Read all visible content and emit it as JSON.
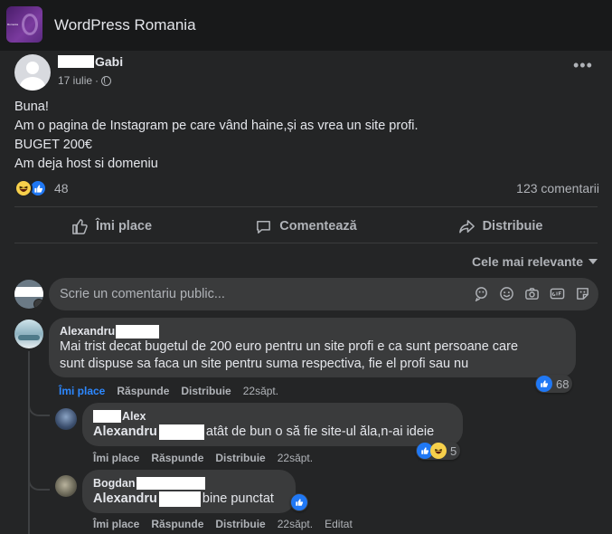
{
  "group": {
    "name": "WordPress Romania",
    "avatar_text": "Romania"
  },
  "post": {
    "author_suffix": "Gabi",
    "date": "17 iulie",
    "separator": "·",
    "lines": [
      "Buna!",
      "Am o pagina de Instagram pe care vând haine,și as vrea un site profi.",
      "BUGET 200€",
      "Am deja host si domeniu"
    ],
    "reaction_count": "48",
    "comment_count": "123 comentarii"
  },
  "actions": {
    "like": "Îmi place",
    "comment": "Comentează",
    "share": "Distribuie"
  },
  "sort_label": "Cele mai relevante",
  "comment_box": {
    "placeholder": "Scrie un comentariu public..."
  },
  "comments": [
    {
      "author_prefix": "Alexandru",
      "text_lines": [
        "Mai trist decat bugetul de 200 euro pentru un site profi e ca sunt persoane care",
        "sunt dispuse sa faca un site pentru suma respectiva, fie el profi sau nu"
      ],
      "actions": [
        "Îmi place",
        "Răspunde",
        "Distribuie"
      ],
      "time": "22săpt.",
      "reaction_count": "68"
    },
    {
      "author_suffix": "Alex",
      "mention": "Alexandru",
      "text": "atât de bun o să fie site-ul ăla,n-ai ideie",
      "actions": [
        "Îmi place",
        "Răspunde",
        "Distribuie"
      ],
      "time": "22săpt.",
      "reaction_count": "5"
    },
    {
      "author_prefix": "Bogdan",
      "mention": "Alexandru",
      "text": "bine punctat",
      "actions": [
        "Îmi place",
        "Răspunde",
        "Distribuie"
      ],
      "time": "22săpt.",
      "edited": "Editat"
    }
  ],
  "colors": {
    "background": "#18191a",
    "card": "#242526",
    "bubble": "#3a3b3c",
    "like_blue": "#2078f4",
    "haha_yellow": "#f7d04b",
    "link_blue": "#2d88ff"
  },
  "icons": [
    "group-avatar",
    "globe-icon",
    "more-icon",
    "like-icon",
    "comment-icon",
    "share-icon",
    "sticker-icon",
    "emoji-icon",
    "camera-icon",
    "gif-icon",
    "sticker-face-icon"
  ]
}
